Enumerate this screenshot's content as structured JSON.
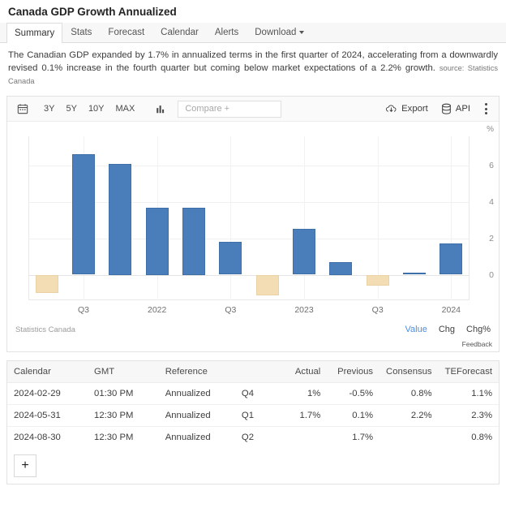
{
  "page": {
    "title": "Canada GDP Growth Annualized"
  },
  "tabs": [
    {
      "label": "Summary",
      "active": true
    },
    {
      "label": "Stats",
      "active": false
    },
    {
      "label": "Forecast",
      "active": false
    },
    {
      "label": "Calendar",
      "active": false
    },
    {
      "label": "Alerts",
      "active": false
    },
    {
      "label": "Download",
      "active": false,
      "caret": true
    }
  ],
  "summary": {
    "text": "The Canadian GDP expanded by 1.7% in annualized terms in the first quarter of 2024, accelerating from a downwardly revised 0.1% increase in the fourth quarter but coming below market expectations of a 2.2% growth.",
    "source_label": "source: Statistics Canada"
  },
  "toolbar": {
    "calendar_icon": "calendar-icon",
    "ranges": [
      "3Y",
      "5Y",
      "10Y",
      "MAX"
    ],
    "chart_type_icon": "bar-chart-icon",
    "compare_placeholder": "Compare +",
    "compare_value": "",
    "export_label": "Export",
    "export_icon": "cloud-download-icon",
    "api_label": "API",
    "api_icon": "database-icon",
    "menu_icon": "kebab-menu-icon"
  },
  "chart_footer": {
    "source": "Statistics Canada",
    "toggles": [
      {
        "label": "Value",
        "active": true
      },
      {
        "label": "Chg",
        "active": false
      },
      {
        "label": "Chg%",
        "active": false
      }
    ],
    "feedback": "Feedback"
  },
  "chart_data": {
    "type": "bar",
    "title": "Canada GDP Growth Annualized",
    "xlabel": "",
    "ylabel": "%",
    "ylim": [
      -1.4,
      7.6
    ],
    "yticks": [
      0,
      2,
      4,
      6
    ],
    "grid": true,
    "legend": "none",
    "axis_unit": "%",
    "categories": [
      "Q2 2021",
      "Q3 2021",
      "Q4 2021",
      "Q1 2022",
      "Q2 2022",
      "Q3 2022",
      "Q4 2022",
      "Q1 2023",
      "Q2 2023",
      "Q3 2023",
      "Q4 2023",
      "Q1 2024"
    ],
    "values": [
      -1.0,
      6.6,
      6.1,
      3.7,
      3.7,
      1.8,
      -1.1,
      2.5,
      0.7,
      -0.6,
      0.1,
      1.7
    ],
    "xtick_labels": [
      "Q3",
      "2022",
      "Q3",
      "2023",
      "Q3",
      "2024"
    ],
    "xtick_categories": [
      "Q3 2021",
      "Q1 2022",
      "Q3 2022",
      "Q1 2023",
      "Q3 2023",
      "Q1 2024"
    ],
    "colors": {
      "positive": "#4a7ebb",
      "negative": "#f3ddb5"
    }
  },
  "table": {
    "columns": [
      {
        "key": "calendar",
        "label": "Calendar",
        "align": "left"
      },
      {
        "key": "gmt",
        "label": "GMT",
        "align": "left"
      },
      {
        "key": "reference",
        "label": "Reference",
        "align": "left"
      },
      {
        "key": "quarter",
        "label": "",
        "align": "left"
      },
      {
        "key": "actual",
        "label": "Actual",
        "align": "right"
      },
      {
        "key": "previous",
        "label": "Previous",
        "align": "right"
      },
      {
        "key": "consensus",
        "label": "Consensus",
        "align": "right"
      },
      {
        "key": "forecast",
        "label": "TEForecast",
        "align": "right"
      }
    ],
    "rows": [
      {
        "calendar": "2024-02-29",
        "gmt": "01:30 PM",
        "reference": "Annualized",
        "quarter": "Q4",
        "actual": "1%",
        "previous": "-0.5%",
        "consensus": "0.8%",
        "forecast": "1.1%"
      },
      {
        "calendar": "2024-05-31",
        "gmt": "12:30 PM",
        "reference": "Annualized",
        "quarter": "Q1",
        "actual": "1.7%",
        "previous": "0.1%",
        "consensus": "2.2%",
        "forecast": "2.3%"
      },
      {
        "calendar": "2024-08-30",
        "gmt": "12:30 PM",
        "reference": "Annualized",
        "quarter": "Q2",
        "actual": "",
        "previous": "1.7%",
        "consensus": "",
        "forecast": "0.8%"
      }
    ],
    "add_row_label": "+"
  }
}
